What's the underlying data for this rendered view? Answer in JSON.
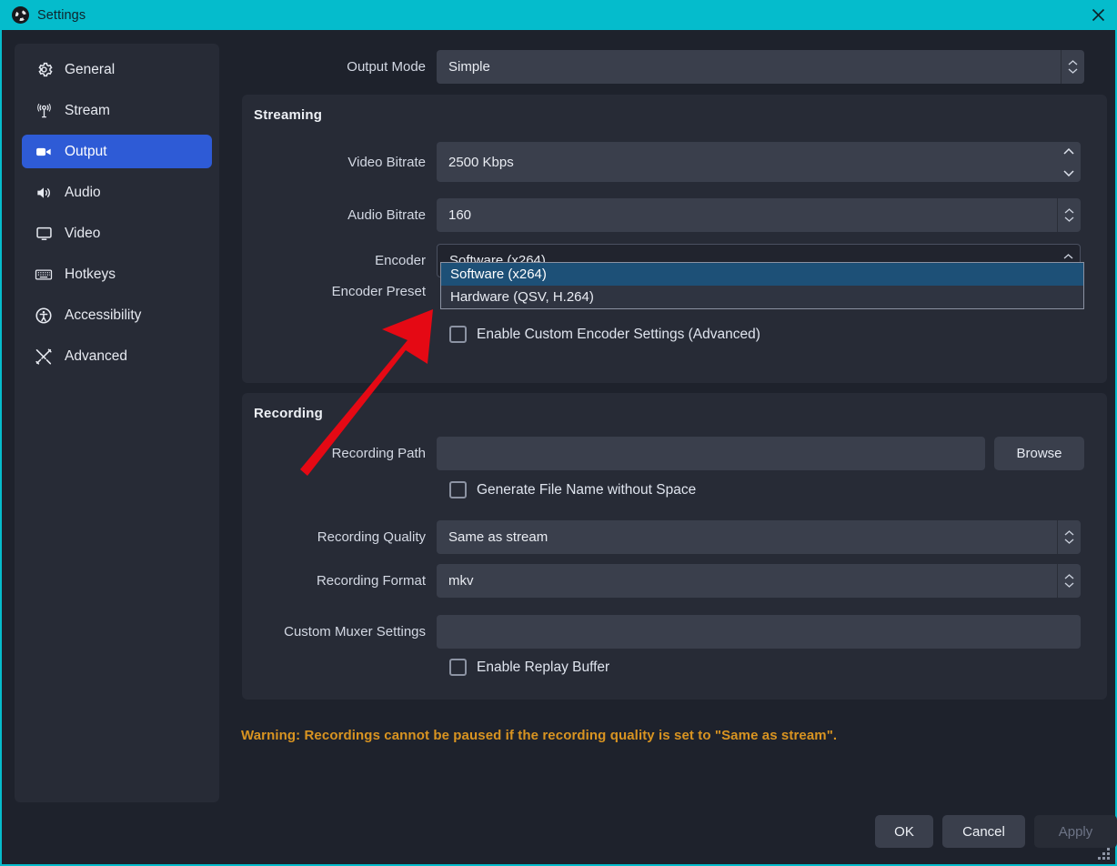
{
  "window": {
    "title": "Settings",
    "logo_icon": "obs-logo-icon",
    "close_icon": "close-icon",
    "accent_color": "#05bccc"
  },
  "sidebar": {
    "items": [
      {
        "label": "General",
        "icon": "gear-icon",
        "selected": false
      },
      {
        "label": "Stream",
        "icon": "broadcast-icon",
        "selected": false
      },
      {
        "label": "Output",
        "icon": "video-camera-icon",
        "selected": true
      },
      {
        "label": "Audio",
        "icon": "speaker-icon",
        "selected": false
      },
      {
        "label": "Video",
        "icon": "monitor-icon",
        "selected": false
      },
      {
        "label": "Hotkeys",
        "icon": "keyboard-icon",
        "selected": false
      },
      {
        "label": "Accessibility",
        "icon": "accessibility-icon",
        "selected": false
      },
      {
        "label": "Advanced",
        "icon": "tools-icon",
        "selected": false
      }
    ],
    "selected_color": "#2e5bd6"
  },
  "output_mode": {
    "label": "Output Mode",
    "value": "Simple"
  },
  "streaming": {
    "title": "Streaming",
    "video_bitrate": {
      "label": "Video Bitrate",
      "value": "2500 Kbps"
    },
    "audio_bitrate": {
      "label": "Audio Bitrate",
      "value": "160"
    },
    "encoder": {
      "label": "Encoder",
      "value": "Software (x264)",
      "open": true,
      "options": [
        {
          "label": "Software (x264)",
          "selected": true
        },
        {
          "label": "Hardware (QSV, H.264)",
          "selected": false
        }
      ],
      "highlight_color": "#1d5077"
    },
    "encoder_preset": {
      "label": "Encoder Preset"
    },
    "custom_encoder": {
      "label": "Enable Custom Encoder Settings (Advanced)",
      "checked": false
    }
  },
  "recording": {
    "title": "Recording",
    "path": {
      "label": "Recording Path",
      "value": "",
      "browse_label": "Browse"
    },
    "no_space": {
      "label": "Generate File Name without Space",
      "checked": false
    },
    "quality": {
      "label": "Recording Quality",
      "value": "Same as stream"
    },
    "format": {
      "label": "Recording Format",
      "value": "mkv"
    },
    "muxer": {
      "label": "Custom Muxer Settings",
      "value": ""
    },
    "replay_buffer": {
      "label": "Enable Replay Buffer",
      "checked": false
    }
  },
  "warning": {
    "text": "Warning: Recordings cannot be paused if the recording quality is set to \"Same as stream\".",
    "color": "#d99421"
  },
  "buttons": {
    "ok": "OK",
    "cancel": "Cancel",
    "apply": "Apply"
  },
  "annotation": {
    "arrow_icon": "red-arrow-icon",
    "color": "#e50914"
  }
}
